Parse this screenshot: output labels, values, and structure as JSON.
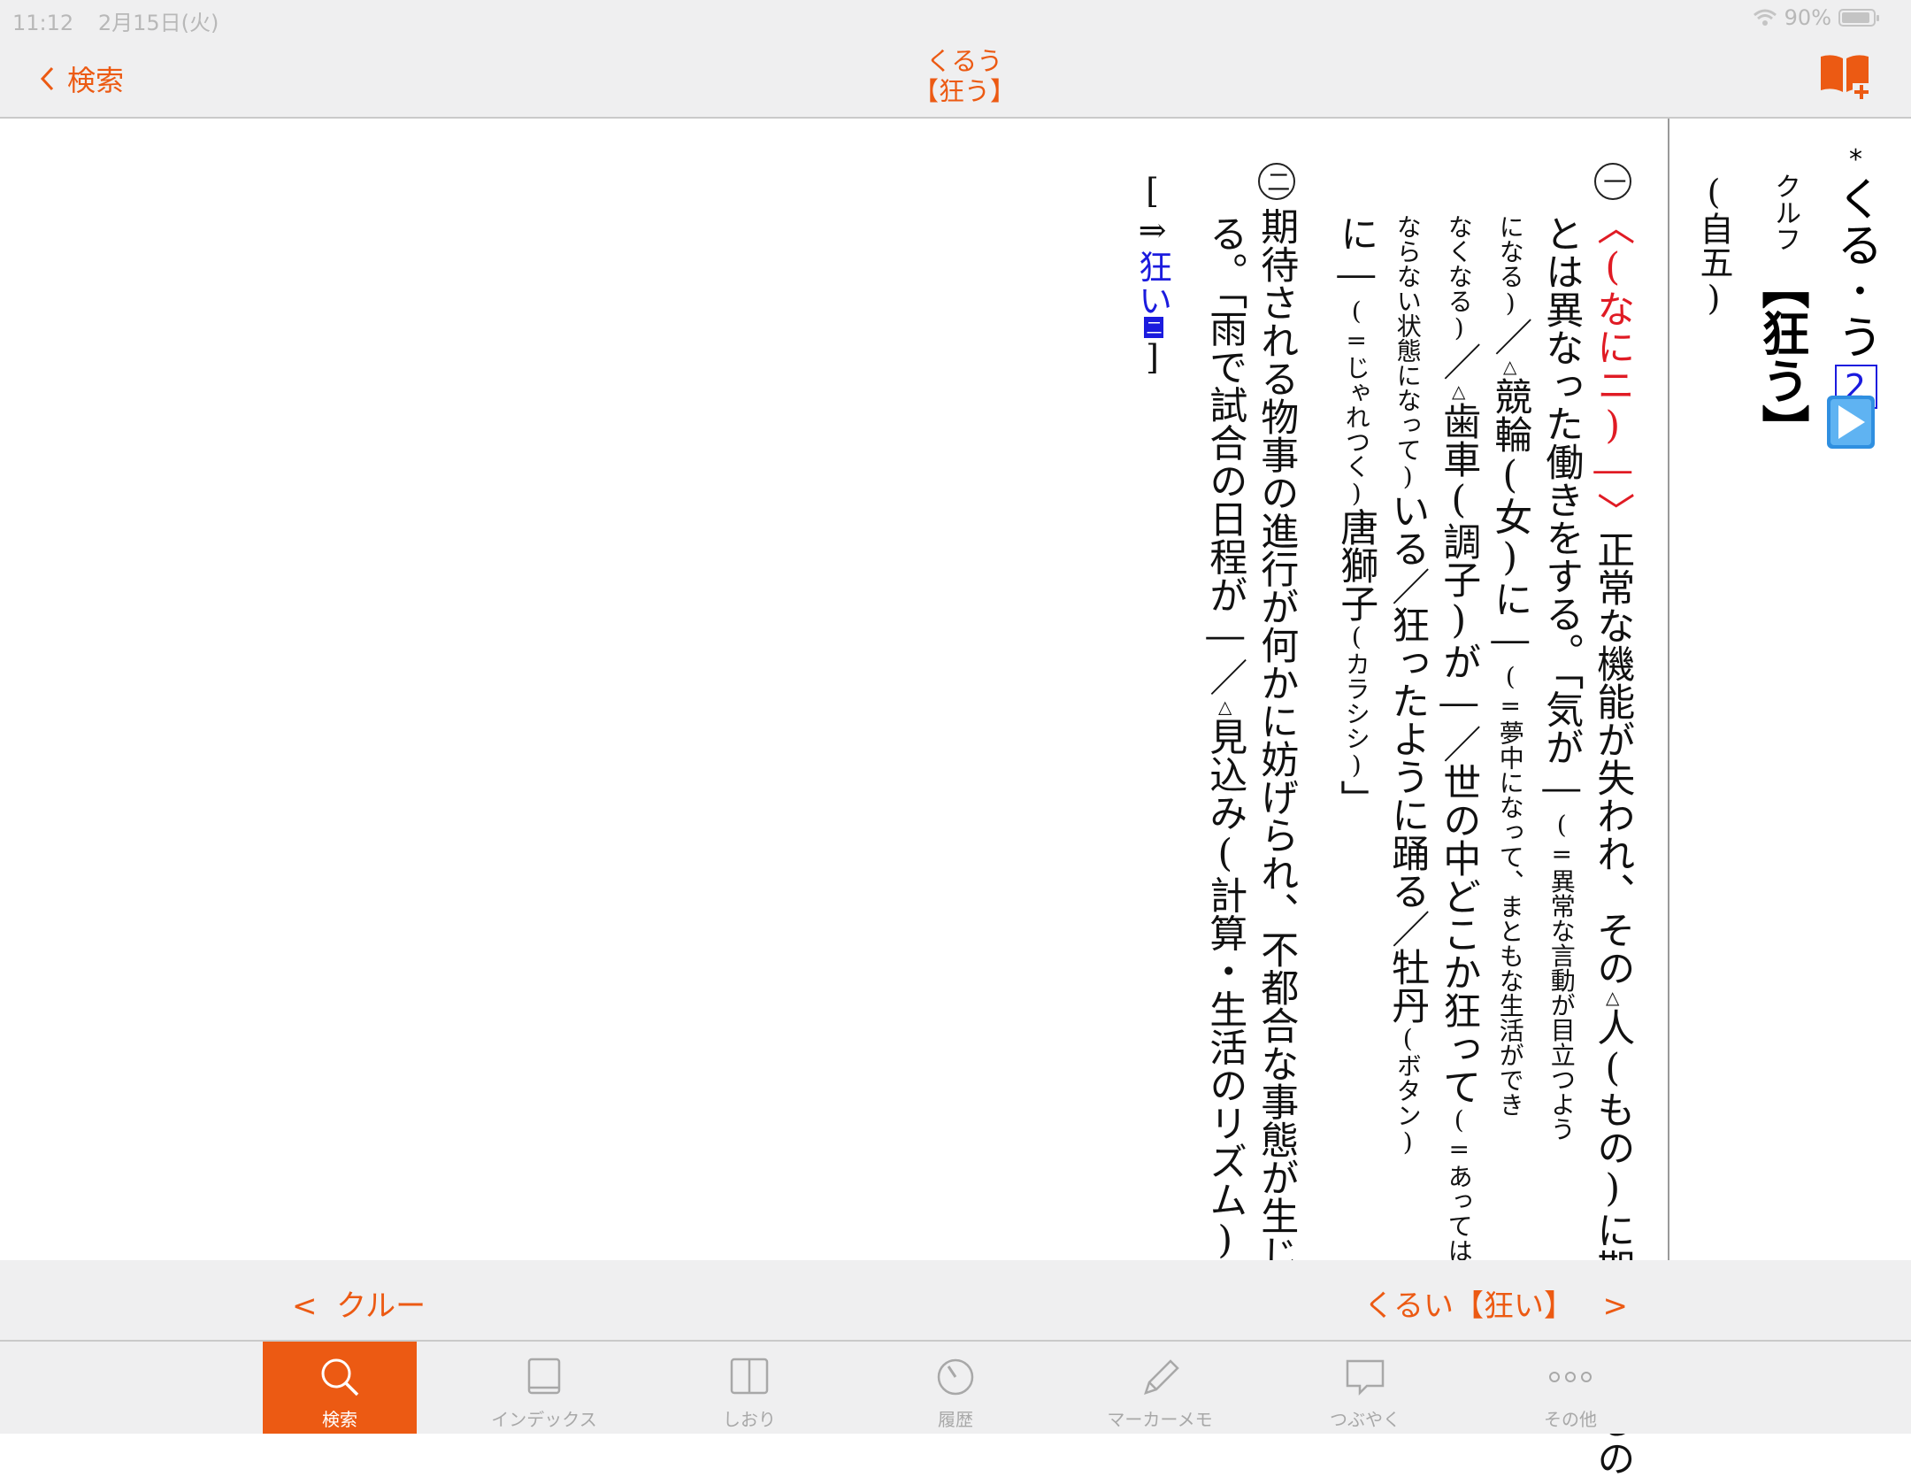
{
  "status_bar": {
    "time": "11:12",
    "date": "2月15日(火)",
    "battery": "90%",
    "battery_level": 0.9
  },
  "nav": {
    "back_label": "検索",
    "title_reading": "くるう",
    "title_word": "【狂う】",
    "icons": {
      "back": "chevron-left-icon",
      "bookmark_add": "book-plus-icon"
    }
  },
  "entry": {
    "headword_star": "*",
    "headword": "くる･う",
    "accent": "2",
    "kana": "クルフ",
    "kanji": "【狂う】",
    "pos": "(自五)",
    "colors": {
      "link": "#1b1bde",
      "pattern": "#e01b24",
      "accent": "#ec5a13"
    },
    "sense1": {
      "marker": "一",
      "pattern": "〈(なに ニ)―〉",
      "lines": [
        {
          "parts": [
            {
              "t": "〈(なに",
              "c": "red"
            },
            {
              "t": "ニ",
              "c": "red"
            },
            {
              "t": ")―〉",
              "c": "red"
            },
            {
              "t": "正常な機能が失われ、その"
            },
            {
              "t": "△",
              "c": "tri"
            },
            {
              "t": "人(もの)に期待されるの"
            }
          ]
        },
        {
          "parts": [
            {
              "t": "とは異なった働きをする。「気が―"
            },
            {
              "t": "(=異常な言動が目立つよう",
              "c": "small"
            }
          ]
        },
        {
          "parts": [
            {
              "t": "になる)",
              "c": "small"
            },
            {
              "t": "／"
            },
            {
              "t": "△",
              "c": "tri"
            },
            {
              "t": "競輪(女)に―"
            },
            {
              "t": "(=夢中になって、まともな生活ができ",
              "c": "small"
            }
          ]
        },
        {
          "parts": [
            {
              "t": "なくなる)",
              "c": "small"
            },
            {
              "t": "／"
            },
            {
              "t": "△",
              "c": "tri"
            },
            {
              "t": "歯車(調子)が―／世の中どこか狂って"
            },
            {
              "t": "(=あっては",
              "c": "small"
            }
          ]
        },
        {
          "parts": [
            {
              "t": "ならない状態になって)",
              "c": "small"
            },
            {
              "t": "いる／狂ったように踊る／牡丹"
            },
            {
              "t": "(ボタン)",
              "c": "small"
            }
          ]
        },
        {
          "parts": [
            {
              "t": "に―"
            },
            {
              "t": "(=じゃれつく)",
              "c": "small"
            },
            {
              "t": "唐獅子"
            },
            {
              "t": "(カラシシ)",
              "c": "small"
            },
            {
              "t": "」"
            }
          ]
        }
      ]
    },
    "sense2": {
      "marker": "二",
      "lines": [
        {
          "parts": [
            {
              "t": "期待される物事の進行が何かに妨げられ、不都合な事態が生じ"
            }
          ]
        },
        {
          "parts": [
            {
              "t": "る。「雨で試合の日程が―／"
            },
            {
              "t": "△",
              "c": "tri"
            },
            {
              "t": "見込み(計算・生活のリズム)が―」"
            }
          ]
        }
      ]
    },
    "xref": {
      "open": "[⇒",
      "link": "狂い",
      "box": "二",
      "close": "]"
    }
  },
  "pager": {
    "prev": "クルー",
    "next": "くるい【狂い】"
  },
  "tabs": [
    {
      "label": "検索",
      "icon": "search-icon",
      "active": true
    },
    {
      "label": "インデックス",
      "icon": "book-closed-icon",
      "active": false
    },
    {
      "label": "しおり",
      "icon": "book-open-icon",
      "active": false
    },
    {
      "label": "履歴",
      "icon": "clock-icon",
      "active": false
    },
    {
      "label": "マーカーメモ",
      "icon": "pencil-icon",
      "active": false
    },
    {
      "label": "つぶやく",
      "icon": "speech-bubble-icon",
      "active": false
    },
    {
      "label": "その他",
      "icon": "more-dots-icon",
      "active": false
    }
  ]
}
